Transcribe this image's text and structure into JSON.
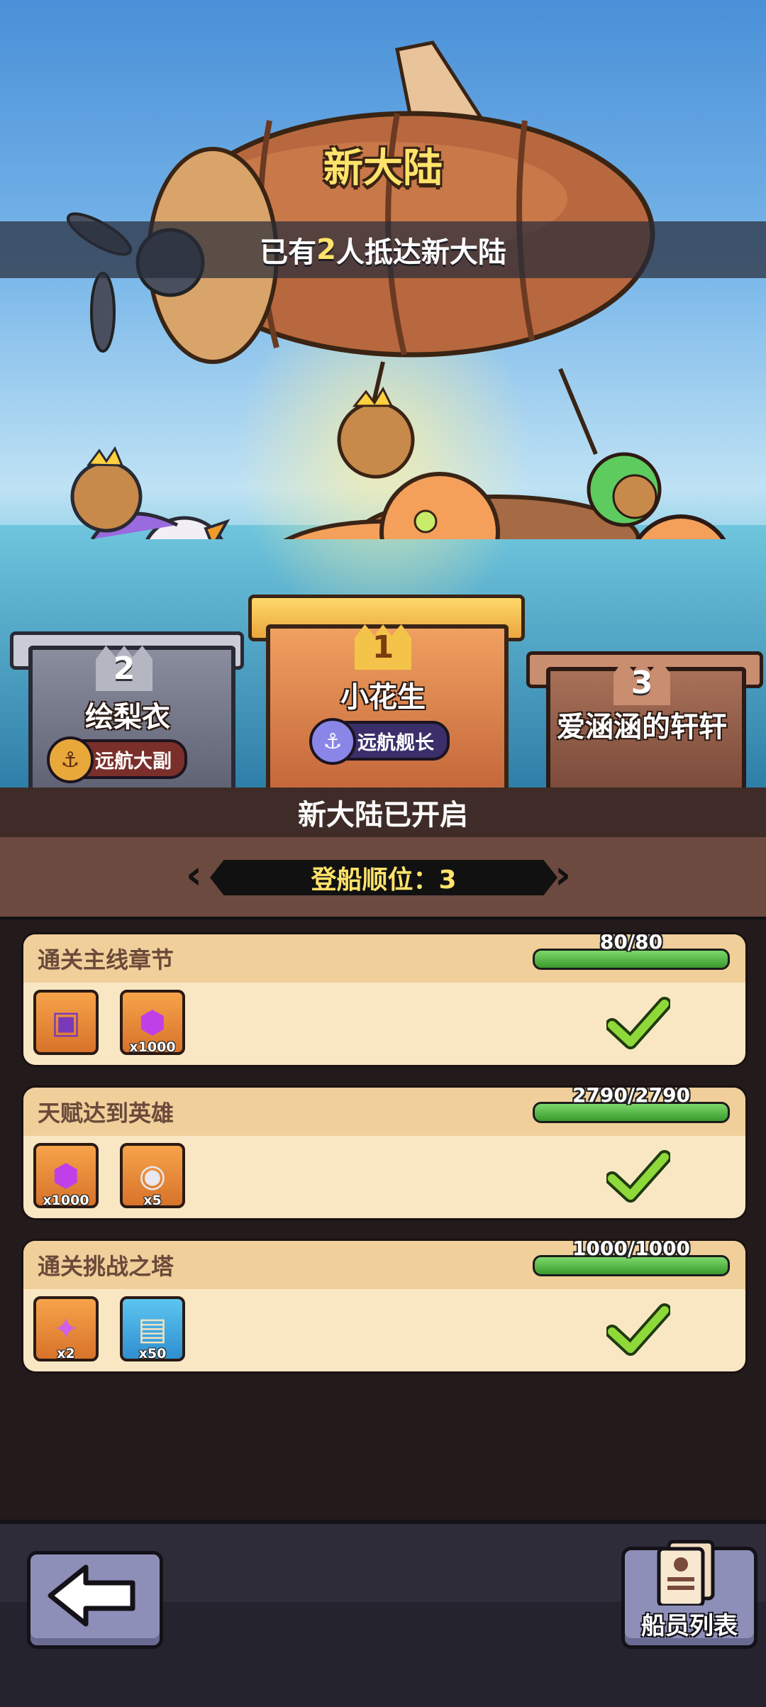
{
  "header": {
    "title": "新大陆",
    "arrival_prefix": "已有",
    "arrival_count": "2",
    "arrival_suffix": "人抵达新大陆"
  },
  "podium": [
    {
      "rank": "1",
      "name": "小花生",
      "title_badge": "远航舰长"
    },
    {
      "rank": "2",
      "name": "绘梨衣",
      "title_badge": "远航大副"
    },
    {
      "rank": "3",
      "name": "爱涵涵的轩轩"
    }
  ],
  "status": {
    "opened_label": "新大陆已开启",
    "boarding_order": "登船顺位：3"
  },
  "tasks": [
    {
      "name": "通关主线章节",
      "progress_text": "80/80",
      "progress": 1.0,
      "completed": true,
      "rewards": [
        {
          "icon": "treasure-chest-icon",
          "count": ""
        },
        {
          "icon": "purple-gem-icon",
          "count": "x1000"
        }
      ]
    },
    {
      "name": "天赋达到英雄",
      "progress_text": "2790/2790",
      "progress": 1.0,
      "completed": true,
      "rewards": [
        {
          "icon": "purple-gem-icon",
          "count": "x1000"
        },
        {
          "icon": "silver-coin-icon",
          "count": "x5"
        }
      ]
    },
    {
      "name": "通关挑战之塔",
      "progress_text": "1000/1000",
      "progress": 1.0,
      "completed": true,
      "rewards": [
        {
          "icon": "magic-scepter-icon",
          "count": "x2"
        },
        {
          "icon": "scroll-icon",
          "count": "x50"
        }
      ]
    }
  ],
  "footer": {
    "back_icon": "back-arrow-icon",
    "crew_list_label": "船员列表",
    "crew_list_icon": "crew-document-icon"
  },
  "colors": {
    "accent_yellow": "#ffe36a",
    "progress_green": "#3a9a2e",
    "panel_dark": "#231a1b"
  }
}
